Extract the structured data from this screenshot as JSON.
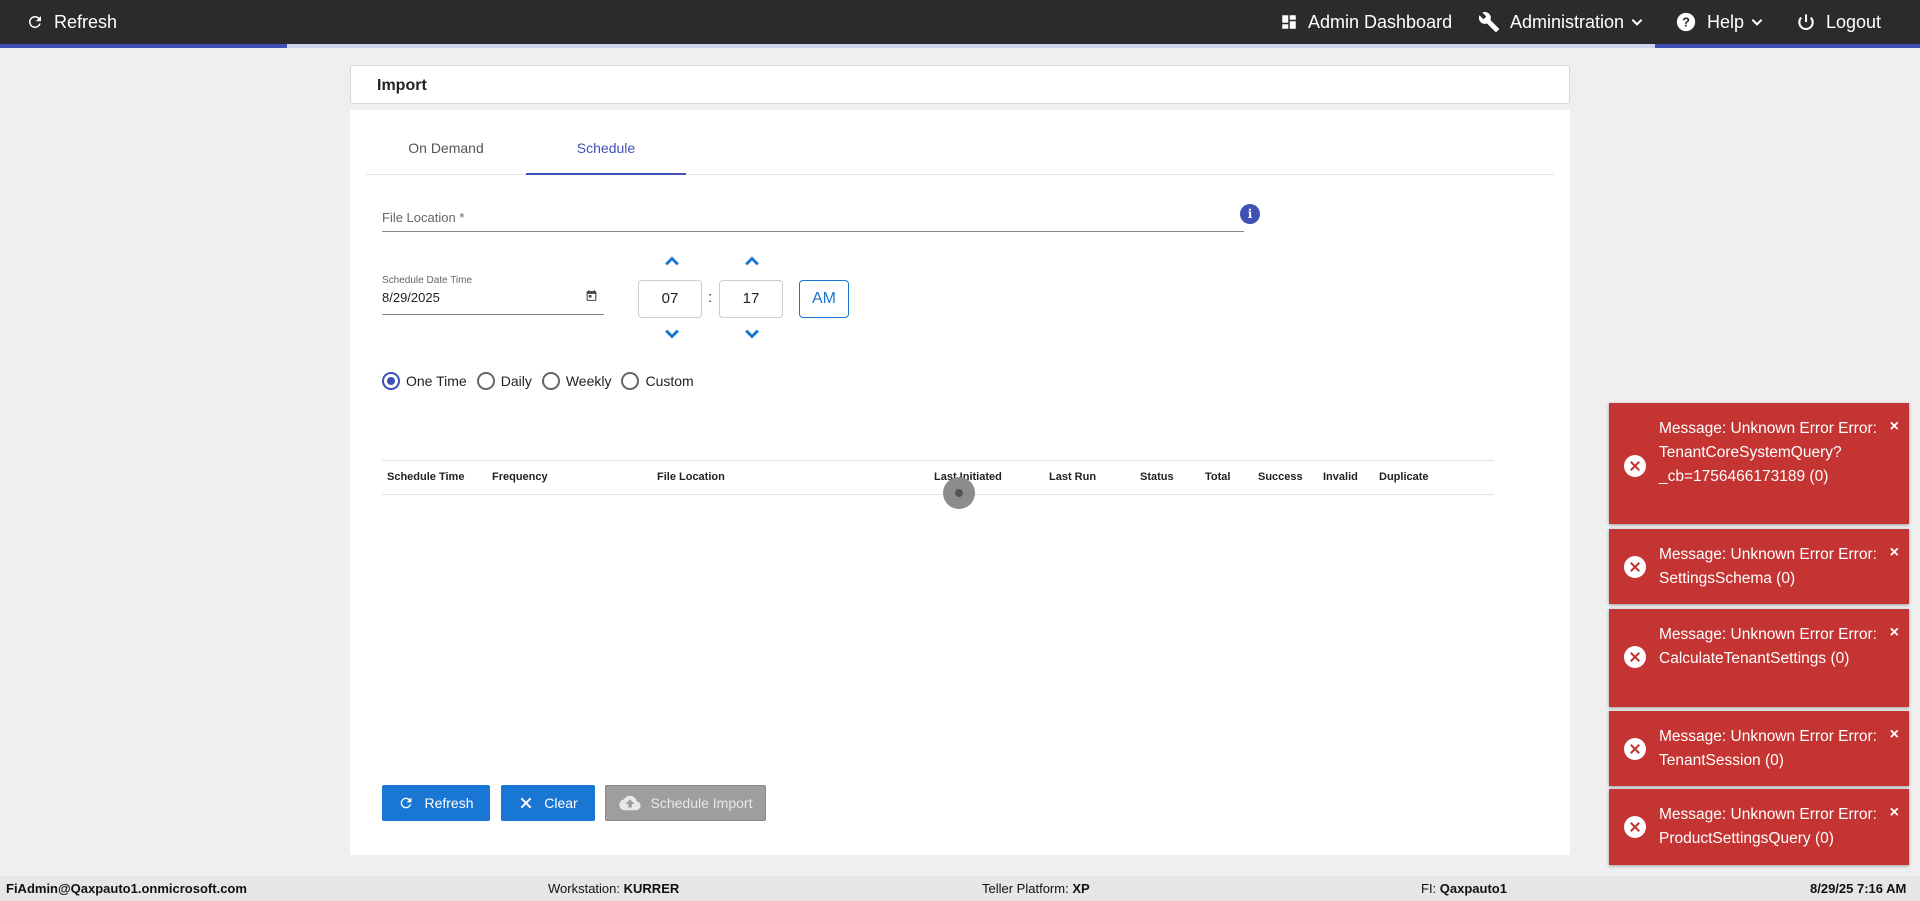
{
  "topbar": {
    "refresh_label": "Refresh",
    "admin_dashboard_label": "Admin Dashboard",
    "administration_label": "Administration",
    "help_label": "Help",
    "logout_label": "Logout"
  },
  "page": {
    "title": "Import"
  },
  "tabs": [
    {
      "label": "On Demand",
      "active": false
    },
    {
      "label": "Schedule",
      "active": true
    }
  ],
  "form": {
    "file_location_label": "File Location *",
    "schedule_label": "Schedule Date Time",
    "schedule_value": "8/29/2025",
    "hour": "07",
    "minute": "17",
    "separator": ":",
    "ampm": "AM",
    "radios": [
      {
        "label": "One Time",
        "checked": true
      },
      {
        "label": "Daily",
        "checked": false
      },
      {
        "label": "Weekly",
        "checked": false
      },
      {
        "label": "Custom",
        "checked": false
      }
    ]
  },
  "table": {
    "columns": [
      "Schedule Time",
      "Frequency",
      "File Location",
      "Last Initiated",
      "Last Run",
      "Status",
      "Total",
      "Success",
      "Invalid",
      "Duplicate"
    ]
  },
  "buttons": {
    "refresh": "Refresh",
    "clear": "Clear",
    "schedule_import": "Schedule Import"
  },
  "toasts": [
    {
      "message": "Message: Unknown Error Error: TenantCoreSystemQuery?_cb=1756466173189 (0)"
    },
    {
      "message": "Message: Unknown Error Error: SettingsSchema (0)"
    },
    {
      "message": "Message: Unknown Error Error: CalculateTenantSettings (0)"
    },
    {
      "message": "Message: Unknown Error Error: TenantSession (0)"
    },
    {
      "message": "Message: Unknown Error Error: ProductSettingsQuery (0)"
    }
  ],
  "toast_close": "×",
  "statusbar": {
    "user": "FiAdmin@Qaxpauto1.onmicrosoft.com",
    "workstation_label": "Workstation:",
    "workstation_value": "KURRER",
    "platform_label": "Teller Platform:",
    "platform_value": "XP",
    "fi_label": "FI:",
    "fi_value": "Qaxpauto1",
    "datetime": "8/29/25 7:16 AM"
  },
  "colors": {
    "topbar": "#2b2b2b",
    "accent": "#3f51b5",
    "primary_button": "#1976d2",
    "error_toast": "#c33432"
  }
}
